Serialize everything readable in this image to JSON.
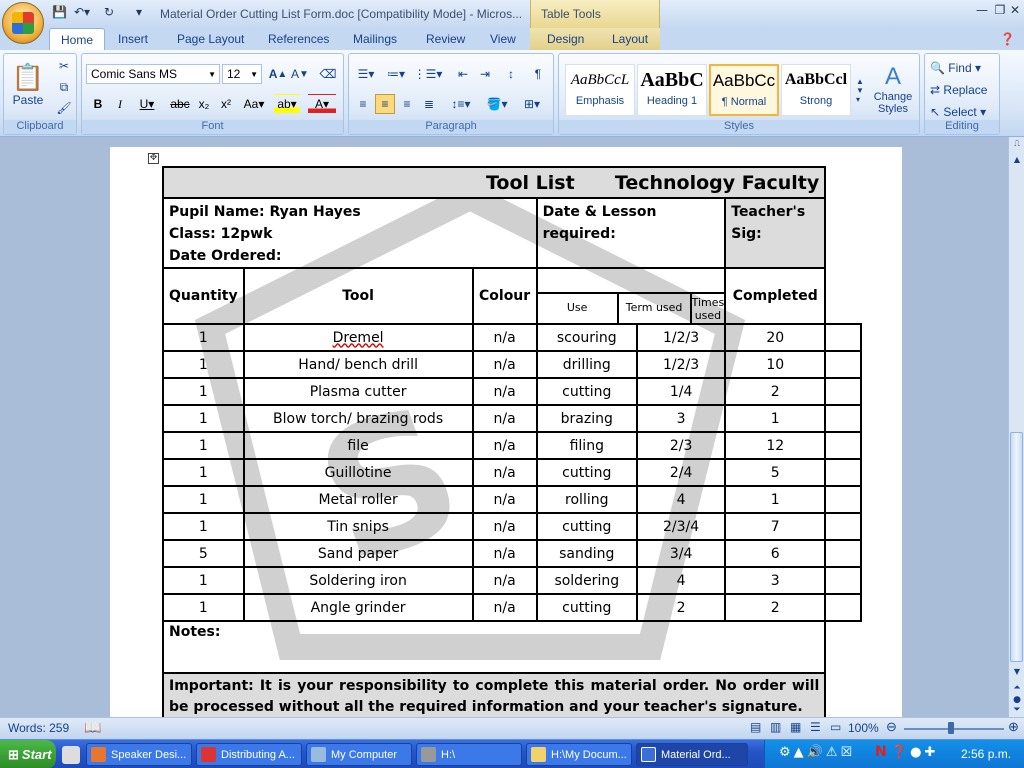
{
  "window": {
    "title": "Material Order Cutting List Form.doc [Compatibility Mode] - Micros...",
    "contextual_tab_group": "Table Tools"
  },
  "tabs": [
    "Home",
    "Insert",
    "Page Layout",
    "References",
    "Mailings",
    "Review",
    "View",
    "Design",
    "Layout"
  ],
  "ribbon": {
    "clipboard": {
      "label": "Clipboard",
      "paste": "Paste"
    },
    "font": {
      "label": "Font",
      "font_name": "Comic Sans MS",
      "font_size": "12"
    },
    "paragraph": {
      "label": "Paragraph"
    },
    "styles": {
      "label": "Styles",
      "items": [
        {
          "sample": "AaBbCcL",
          "name": "Emphasis"
        },
        {
          "sample": "AaBbC",
          "name": "Heading 1"
        },
        {
          "sample": "AaBbCc",
          "name": "¶ Normal"
        },
        {
          "sample": "AaBbCcl",
          "name": "Strong"
        }
      ],
      "change_styles": "Change Styles"
    },
    "editing": {
      "label": "Editing",
      "find": "Find",
      "replace": "Replace",
      "select": "Select"
    }
  },
  "document": {
    "header_title": "Tool List",
    "header_faculty": "Technology Faculty",
    "pupil_name": "Pupil Name: Ryan Hayes",
    "class": "Class: 12pwk",
    "date_ordered": "Date Ordered:",
    "date_lesson": "Date & Lesson required:",
    "teacher_sig": "Teacher's Sig:",
    "columns": {
      "quantity": "Quantity",
      "tool": "Tool",
      "colour": "Colour",
      "use": "Use",
      "term_used": "Term used",
      "times_used": "Times used",
      "completed": "Completed"
    },
    "rows": [
      {
        "qty": "1",
        "tool": "Dremel",
        "colour": "n/a",
        "use": "scouring",
        "term": "1/2/3",
        "times": "20"
      },
      {
        "qty": "1",
        "tool": "Hand/ bench drill",
        "colour": "n/a",
        "use": "drilling",
        "term": "1/2/3",
        "times": "10"
      },
      {
        "qty": "1",
        "tool": "Plasma cutter",
        "colour": "n/a",
        "use": "cutting",
        "term": "1/4",
        "times": "2"
      },
      {
        "qty": "1",
        "tool": "Blow torch/ brazing rods",
        "colour": "n/a",
        "use": "brazing",
        "term": "3",
        "times": "1"
      },
      {
        "qty": "1",
        "tool": "file",
        "colour": "n/a",
        "use": "filing",
        "term": "2/3",
        "times": "12"
      },
      {
        "qty": "1",
        "tool": "Guillotine",
        "colour": "n/a",
        "use": "cutting",
        "term": "2/4",
        "times": "5"
      },
      {
        "qty": "1",
        "tool": "Metal roller",
        "colour": "n/a",
        "use": "rolling",
        "term": "4",
        "times": "1"
      },
      {
        "qty": "1",
        "tool": "Tin snips",
        "colour": "n/a",
        "use": "cutting",
        "term": "2/3/4",
        "times": "7"
      },
      {
        "qty": "5",
        "tool": "Sand paper",
        "colour": "n/a",
        "use": "sanding",
        "term": "3/4",
        "times": "6"
      },
      {
        "qty": "1",
        "tool": "Soldering iron",
        "colour": "n/a",
        "use": "soldering",
        "term": "4",
        "times": "3"
      },
      {
        "qty": "1",
        "tool": "Angle grinder",
        "colour": "n/a",
        "use": "cutting",
        "term": "2",
        "times": "2"
      }
    ],
    "notes": "Notes:",
    "important": "Important: It is your responsibility to complete this material order. No order will be processed without all the required information and your teacher's signature."
  },
  "status": {
    "words": "Words: 259",
    "zoom": "100%"
  },
  "taskbar": {
    "start": "Start",
    "items": [
      "Speaker Desi...",
      "Distributing A...",
      "My Computer",
      "H:\\",
      "H:\\My Docum...",
      "Material Ord..."
    ],
    "clock": "2:56 p.m."
  }
}
